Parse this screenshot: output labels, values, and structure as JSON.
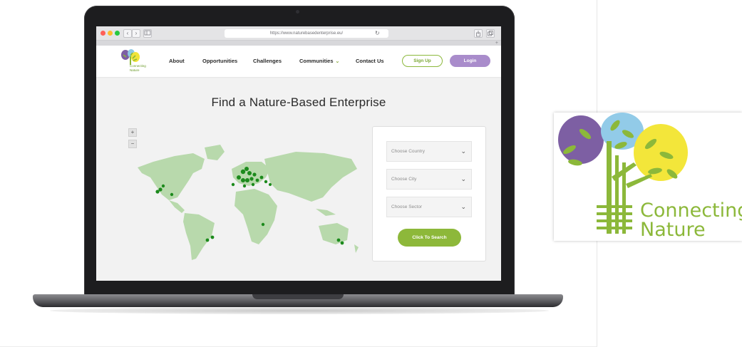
{
  "browser": {
    "url": "https://www.naturebasedenterprise.eu/",
    "back_glyph": "‹",
    "forward_glyph": "›",
    "reload_glyph": "↻",
    "new_tab_glyph": "+"
  },
  "header": {
    "logo_text_line1": "Connecting",
    "logo_text_line2": "Nature",
    "nav": [
      {
        "label": "About"
      },
      {
        "label": "Opportunities"
      },
      {
        "label": "Challenges"
      },
      {
        "label": "Communities"
      },
      {
        "label": "Contact Us"
      }
    ],
    "communities_chevron": "⌄",
    "signup_label": "Sign Up",
    "login_label": "Login"
  },
  "main": {
    "title": "Find a Nature-Based Enterprise",
    "zoom_in": "+",
    "zoom_out": "−",
    "filters": [
      {
        "label": "Choose Country"
      },
      {
        "label": "Choose City"
      },
      {
        "label": "Choose Sector"
      }
    ],
    "select_chevron": "⌄",
    "search_button": "Click To Search"
  },
  "brand_logo": {
    "line1": "Connecting",
    "line2": "Nature"
  },
  "colors": {
    "accent_green": "#8db83a",
    "login_purple": "#a98ccb",
    "map_land": "#b8d9ac",
    "map_marker": "#1c8a1c"
  },
  "icons": [
    "back-icon",
    "forward-icon",
    "sidebar-icon",
    "reload-icon",
    "share-icon",
    "tabs-icon",
    "chevron-down-icon",
    "map-marker-icon",
    "tree-logo-icon"
  ]
}
